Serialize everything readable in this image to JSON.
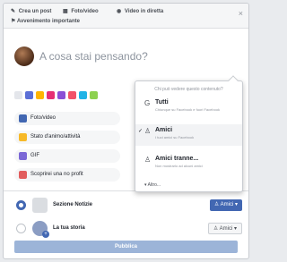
{
  "topbar": {
    "tabs": [
      {
        "icon": "pencil-icon",
        "glyph": "✎",
        "label": "Crea un post"
      },
      {
        "icon": "photo-icon",
        "glyph": "▦",
        "label": "Foto/video"
      },
      {
        "icon": "live-video-icon",
        "glyph": "◉",
        "label": "Video in diretta"
      }
    ],
    "sublink": {
      "icon": "flag-icon",
      "glyph": "⚑",
      "label": "Avvenimento importante"
    },
    "close_glyph": "×"
  },
  "composer": {
    "placeholder": "A cosa stai pensando?"
  },
  "colors": [
    "#e4e6eb",
    "#5b6fd6",
    "#ffb400",
    "#e62f74",
    "#8b4fd6",
    "#f25268",
    "#20b3e6",
    "#8dd14f"
  ],
  "actions": [
    {
      "icon": "photo-icon",
      "color": "#4267b2",
      "label": "Foto/video"
    },
    {
      "icon": "feeling-icon",
      "color": "#f7b928",
      "label": "Stato d'animo/attività"
    },
    {
      "icon": "gif-icon",
      "color": "#7b68d6",
      "label": "GIF"
    },
    {
      "icon": "search-friends-icon",
      "color": "#e25d5d",
      "label": "Scoprirei una no profit"
    }
  ],
  "share": [
    {
      "label": "Sezione Notizie",
      "checked": true,
      "button": "Amici ▾",
      "button_icon": "friends-icon"
    },
    {
      "label": "La tua storia",
      "checked": false,
      "button": "Amici ▾",
      "button_icon": "friends-icon"
    }
  ],
  "publish_label": "Pubblica",
  "popover": {
    "header": "Chi può vedere questo contenuto?",
    "options": [
      {
        "icon": "globe-icon",
        "glyph": "G",
        "title": "Tutti",
        "desc": "Chiunque su Facebook e fuori Facebook",
        "selected": false
      },
      {
        "icon": "friends-icon",
        "glyph": "♙",
        "title": "Amici",
        "desc": "I tuoi amici su Facebook",
        "selected": true
      },
      {
        "icon": "friends-except-icon",
        "glyph": "♙",
        "title": "Amici tranne...",
        "desc": "Non mostrarlo ad alcuni amici",
        "selected": false
      }
    ],
    "more": "▾  Altro..."
  }
}
